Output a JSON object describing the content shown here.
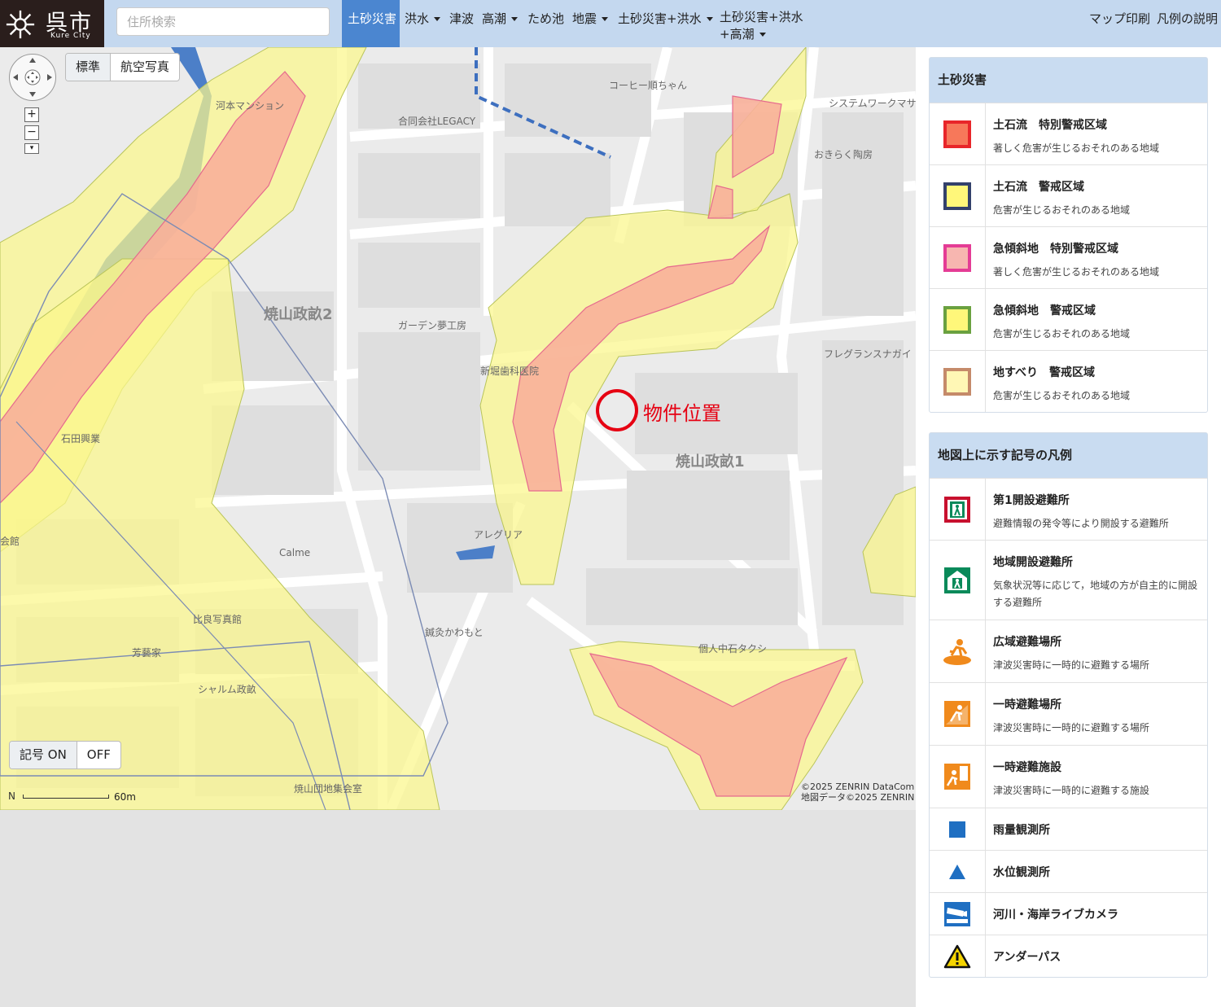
{
  "header": {
    "logo": {
      "title": "呉市",
      "subtitle": "Kure City"
    },
    "search": {
      "placeholder": "住所検索"
    },
    "nav": [
      {
        "label": "土砂災害",
        "active": true,
        "dropdown": false
      },
      {
        "label": "洪水",
        "dropdown": true
      },
      {
        "label": "津波",
        "dropdown": false
      },
      {
        "label": "高潮",
        "dropdown": true
      },
      {
        "label": "ため池",
        "dropdown": false
      },
      {
        "label": "地震",
        "dropdown": true
      },
      {
        "label": "土砂災害+洪水",
        "dropdown": true
      },
      {
        "label_line1": "土砂災害+洪水",
        "label_line2": "+高潮",
        "dropdown": true
      }
    ],
    "print": "マップ印刷",
    "legend_help": "凡例の説明"
  },
  "map": {
    "basemap": {
      "standard": "標準",
      "aerial": "航空写真"
    },
    "symbols": {
      "on": "記号 ON",
      "off": "OFF"
    },
    "marker_label": "物件位置",
    "scale": "60m",
    "north": "N",
    "copyright_line1": "©2025 ZENRIN DataCom",
    "copyright_line2": "地図データ©2025 ZENRIN",
    "areas": {
      "a1": "焼山政畝2",
      "a2": "焼山政畝1"
    },
    "places": {
      "p1": "コーヒー順ちゃん",
      "p2": "合同会社LEGACY",
      "p3": "河本マンション",
      "p4": "システムワークマサ",
      "p5": "おきらく陶房",
      "p6": "ガーデン夢工房",
      "p7": "新堀歯科医院",
      "p8": "フレグランスナガイ",
      "p9": "石田興業",
      "p10": "アレグリア",
      "p11": "Calme",
      "p12": "比良写真館",
      "p13": "芳藝家",
      "p14": "シャルム政畝",
      "p15": "鍼灸かわもと",
      "p16": "個人中石タクシ",
      "p17": "焼山団地集会室",
      "p18": "会館"
    }
  },
  "legend": {
    "sediment": {
      "title": "土砂災害",
      "items": [
        {
          "name": "土石流　特別警戒区域",
          "desc": "著しく危害が生じるおそれのある地域",
          "fill": "#f7785a",
          "border": "#e8262a"
        },
        {
          "name": "土石流　警戒区域",
          "desc": "危害が生じるおそれのある地域",
          "fill": "#fff77a",
          "border": "#33416b"
        },
        {
          "name": "急傾斜地　特別警戒区域",
          "desc": "著しく危害が生じるおそれのある地域",
          "fill": "#f7b6b0",
          "border": "#e43c95"
        },
        {
          "name": "急傾斜地　警戒区域",
          "desc": "危害が生じるおそれのある地域",
          "fill": "#fff77a",
          "border": "#6aa140"
        },
        {
          "name": "地すべり　警戒区域",
          "desc": "危害が生じるおそれのある地域",
          "fill": "#fff7b5",
          "border": "#c58a6a"
        }
      ]
    },
    "symbols": {
      "title": "地図上に示す記号の凡例",
      "items": [
        {
          "name": "第1開設避難所",
          "desc": "避難情報の発令等により開設する避難所",
          "icon": "first-shelter-icon"
        },
        {
          "name": "地域開設避難所",
          "desc": "気象状況等に応じて，地域の方が自主的に開設する避難所",
          "icon": "local-shelter-icon"
        },
        {
          "name": "広域避難場所",
          "desc": "津波災害時に一時的に避難する場所",
          "icon": "wide-evacuation-icon"
        },
        {
          "name": "一時避難場所",
          "desc": "津波災害時に一時的に避難する場所",
          "icon": "temporary-evacuation-icon"
        },
        {
          "name": "一時避難施設",
          "desc": "津波災害時に一時的に避難する施設",
          "icon": "temporary-facility-icon"
        },
        {
          "name": "雨量観測所",
          "icon": "rain-gauge-icon"
        },
        {
          "name": "水位観測所",
          "icon": "water-level-icon"
        },
        {
          "name": "河川・海岸ライブカメラ",
          "icon": "live-camera-icon"
        },
        {
          "name": "アンダーパス",
          "icon": "underpass-warning-icon"
        }
      ]
    }
  }
}
